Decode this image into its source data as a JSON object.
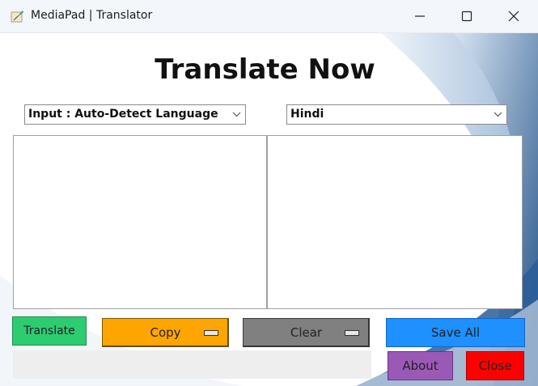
{
  "window": {
    "title": "MediaPad | Translator",
    "icon": "feather-quill-icon",
    "controls": [
      "minimize-icon",
      "maximize-icon",
      "close-icon"
    ]
  },
  "heading": "Translate Now",
  "input_language": {
    "selected": "Input : Auto-Detect Language",
    "icon": "chevron-down-icon"
  },
  "output_language": {
    "selected": "Hindi",
    "icon": "chevron-down-icon"
  },
  "input_text": "",
  "output_text": "",
  "buttons": {
    "translate": "Translate",
    "copy": "Copy",
    "clear": "Clear",
    "save_all": "Save All",
    "about": "About",
    "close": "Close"
  },
  "status_text": "",
  "colors": {
    "translate": "#2ecc71",
    "copy": "#ffa500",
    "clear": "#808080",
    "save_all": "#1e90ff",
    "about": "#9b59b6",
    "close": "#ff0000",
    "background_accent": "#1f4f86"
  }
}
